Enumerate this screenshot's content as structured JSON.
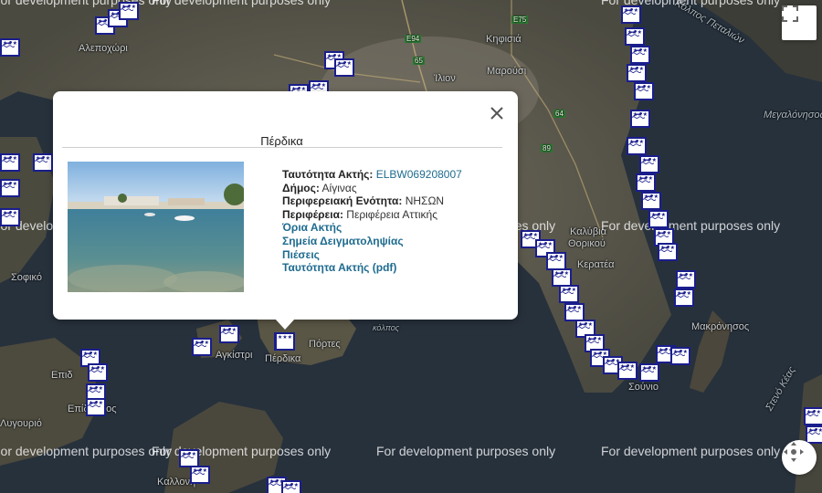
{
  "watermark": "For development purposes only",
  "places": [
    "Κηφισιά",
    "Μαρούσι",
    "Ίλιον",
    "Αλεποχώρι",
    "Καλύβια",
    "Θορικού",
    "Κερατέα",
    "Σοφικό",
    "Επίδαυρος",
    "Πόρτες",
    "Πέρδικα",
    "Σούνιο",
    "Μακρόνησος",
    "Αγκίστρι",
    "Καλλονή",
    "Μεγαλόνησος",
    "Κόλπος Πεταλιών",
    "Στενό Κέας",
    "Λυγουριό",
    "κόλπος",
    "Επιδ"
  ],
  "road_badges": [
    "E75",
    "E94",
    "65",
    "64",
    "89"
  ],
  "marker_stars": "★★★",
  "controls": {
    "fullscreen_icon": "fullscreen-icon",
    "camera_icon": "camera-control-icon"
  },
  "popup": {
    "title": "Πέρδικα",
    "close_icon": "close-icon",
    "rows": [
      {
        "label": "Ταυτότητα Ακτής:",
        "value": "ELBW069208007"
      },
      {
        "label": "Δήμος:",
        "value": "Αίγινας"
      },
      {
        "label": "Περιφερειακή Ενότητα:",
        "value": "ΝΗΣΩΝ"
      },
      {
        "label": "Περιφέρεια:",
        "value": "Περιφέρεια Αττικής"
      }
    ],
    "links": [
      "Όρια Ακτής",
      "Σημεία Δειγματοληψίας",
      "Πιέσεις",
      "Ταυτότητα Ακτής (pdf)"
    ]
  }
}
